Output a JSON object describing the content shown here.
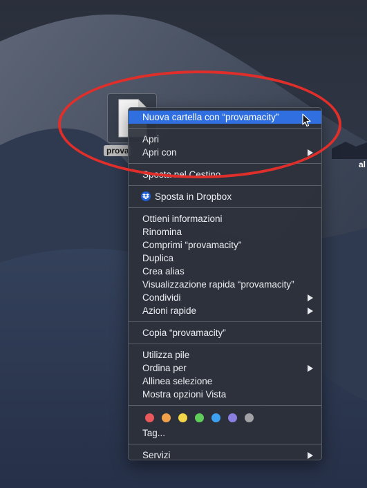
{
  "desktop": {
    "file_label": "prova",
    "edge_label": "al"
  },
  "menu": {
    "groups": [
      {
        "items": [
          {
            "label": "Nuova cartella con “provamacity”",
            "highlight": true
          }
        ]
      },
      {
        "items": [
          {
            "label": "Apri"
          },
          {
            "label": "Apri con",
            "submenu": true
          }
        ]
      },
      {
        "items": [
          {
            "label": "Sposta nel Cestino"
          }
        ]
      },
      {
        "items": [
          {
            "label": "Sposta in Dropbox",
            "icon": "dropbox-icon"
          }
        ]
      },
      {
        "items": [
          {
            "label": "Ottieni informazioni"
          },
          {
            "label": "Rinomina"
          },
          {
            "label": "Comprimi “provamacity”"
          },
          {
            "label": "Duplica"
          },
          {
            "label": "Crea alias"
          },
          {
            "label": "Visualizzazione rapida “provamacity”"
          },
          {
            "label": "Condividi",
            "submenu": true
          },
          {
            "label": "Azioni rapide",
            "submenu": true
          }
        ]
      },
      {
        "items": [
          {
            "label": "Copia “provamacity”"
          }
        ]
      },
      {
        "items": [
          {
            "label": "Utilizza pile"
          },
          {
            "label": "Ordina per",
            "submenu": true
          },
          {
            "label": "Allinea selezione"
          },
          {
            "label": "Mostra opzioni Vista"
          }
        ]
      }
    ],
    "tags": {
      "colors": [
        "#e9585a",
        "#f2a14a",
        "#f2d548",
        "#5fcf5a",
        "#3ea0f0",
        "#8a7fe0",
        "#a2a2a6"
      ],
      "label": "Tag..."
    },
    "services": {
      "label": "Servizi",
      "submenu": true
    }
  },
  "colors": {
    "highlight": "#2f6fe0",
    "annotation": "#e02f2a",
    "dropbox": "#1f5fd6"
  }
}
